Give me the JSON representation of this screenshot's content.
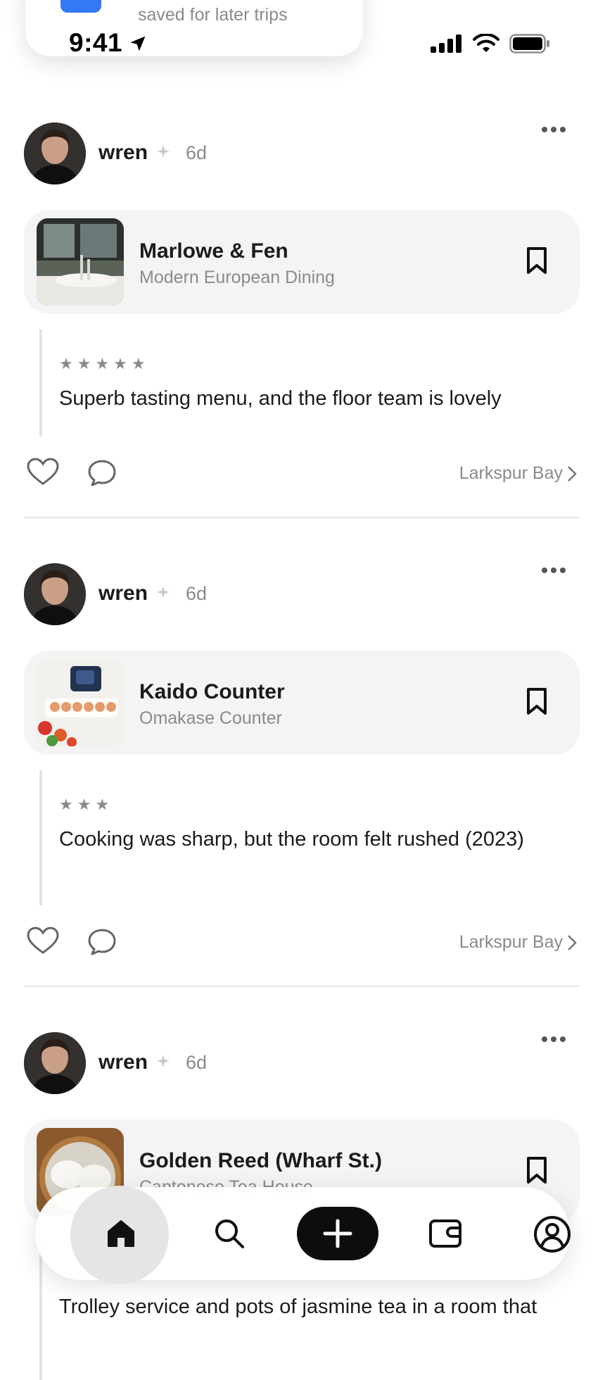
{
  "status_bar": {
    "time": "9:41"
  },
  "notification": {
    "subtitle": "saved for later trips"
  },
  "posts": [
    {
      "user": "wren",
      "age": "6d",
      "place": "Marlowe & Fen",
      "category": "Modern European Dining",
      "rating": 5,
      "stars": "★★★★★",
      "review": "Superb tasting menu, and the floor team is lovely",
      "location": "Larkspur Bay"
    },
    {
      "user": "wren",
      "age": "6d",
      "place": "Kaido Counter",
      "category": "Omakase Counter",
      "rating": 3,
      "stars": "★★★",
      "review": "Cooking was sharp, but the room felt rushed (2023)",
      "location": "Larkspur Bay"
    },
    {
      "user": "wren",
      "age": "6d",
      "place": "Golden Reed (Wharf St.)",
      "category": "Cantonese Tea House",
      "review": "Trolley service and pots of jasmine tea in a room that"
    }
  ],
  "nav": {
    "items": [
      "home-icon",
      "search-icon",
      "add-icon",
      "wallet-icon",
      "profile-icon"
    ],
    "active": "home-icon"
  },
  "colors": {
    "accent": "#3478f6",
    "muted": "#8a8a8e",
    "card": "#f4f4f4",
    "primary": "#0d0d0d"
  }
}
